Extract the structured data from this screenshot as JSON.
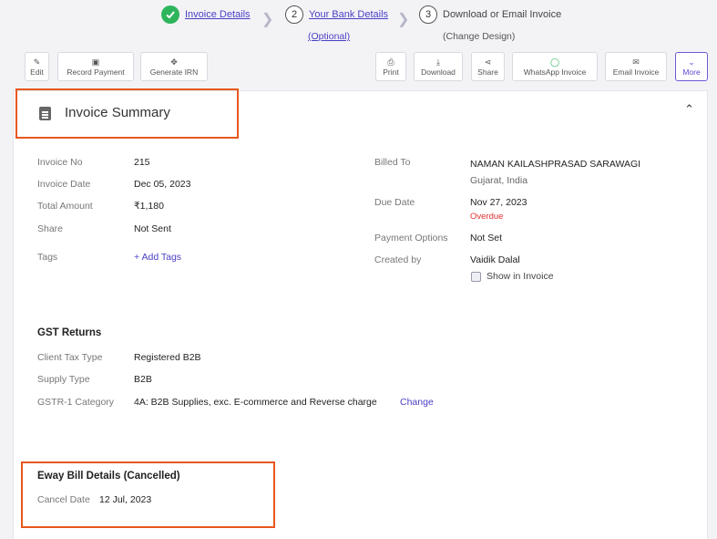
{
  "stepper": {
    "step1_label": "Invoice Details",
    "step2_num": "2",
    "step2_label": "Your Bank Details",
    "step2_sub": "(Optional)",
    "step3_num": "3",
    "step3_label": "Download or Email Invoice",
    "step3_sub": "(Change Design)"
  },
  "toolbar": {
    "edit": "Edit",
    "record_payment": "Record Payment",
    "generate_irn": "Generate IRN",
    "print": "Print",
    "download": "Download",
    "share": "Share",
    "whatsapp": "WhatsApp Invoice",
    "email": "Email Invoice",
    "more": "More"
  },
  "summary": {
    "title": "Invoice Summary",
    "invoice_no_label": "Invoice No",
    "invoice_no": "215",
    "invoice_date_label": "Invoice Date",
    "invoice_date": "Dec 05, 2023",
    "total_amount_label": "Total Amount",
    "total_amount": "₹1,180",
    "share_label": "Share",
    "share_value": "Not Sent",
    "tags_label": "Tags",
    "add_tags": "+ Add Tags",
    "billed_to_label": "Billed To",
    "billed_to_name": "NAMAN KAILASHPRASAD SARAWAGI",
    "billed_to_location": "Gujarat, India",
    "due_date_label": "Due Date",
    "due_date": "Nov 27, 2023",
    "due_status": "Overdue",
    "payment_options_label": "Payment Options",
    "payment_options": "Not Set",
    "created_by_label": "Created by",
    "created_by": "Vaidik Dalal",
    "show_in_invoice": "Show in Invoice"
  },
  "gst": {
    "heading": "GST Returns",
    "client_tax_type_label": "Client Tax Type",
    "client_tax_type": "Registered B2B",
    "supply_type_label": "Supply Type",
    "supply_type": "B2B",
    "gstr1_label": "GSTR-1 Category",
    "gstr1_value": "4A: B2B Supplies, exc. E-commerce and Reverse charge",
    "change": "Change"
  },
  "eway": {
    "heading": "Eway Bill Details (Cancelled)",
    "cancel_date_label": "Cancel Date",
    "cancel_date": "12 Jul, 2023"
  },
  "colors": {
    "accent": "#4a3fc4",
    "success": "#2eb55c",
    "highlight": "#e8571e",
    "overdue": "#e03030"
  }
}
